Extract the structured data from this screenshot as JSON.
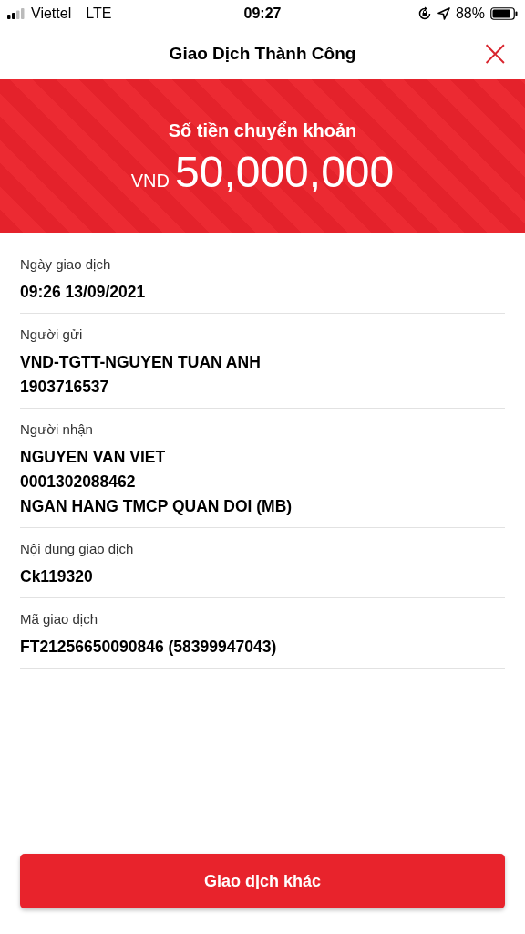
{
  "status_bar": {
    "carrier": "Viettel",
    "network": "LTE",
    "time": "09:27",
    "battery": "88%"
  },
  "header": {
    "title": "Giao Dịch Thành Công",
    "close": "×"
  },
  "banner": {
    "label": "Số tiền chuyển khoản",
    "currency": "VND",
    "amount": "50,000,000"
  },
  "details": [
    {
      "label": "Ngày giao dịch",
      "lines": [
        "09:26 13/09/2021"
      ]
    },
    {
      "label": "Người gửi",
      "lines": [
        "VND-TGTT-NGUYEN TUAN ANH",
        "1903716537"
      ]
    },
    {
      "label": "Người nhận",
      "lines": [
        "NGUYEN VAN VIET",
        "0001302088462",
        "NGAN HANG TMCP QUAN DOI (MB)"
      ]
    },
    {
      "label": "Nội dung giao dịch",
      "lines": [
        "Ck119320"
      ]
    },
    {
      "label": "Mã giao dịch",
      "lines": [
        "FT21256650090846 (58399947043)"
      ]
    }
  ],
  "button": {
    "label": "Giao dịch khác"
  }
}
